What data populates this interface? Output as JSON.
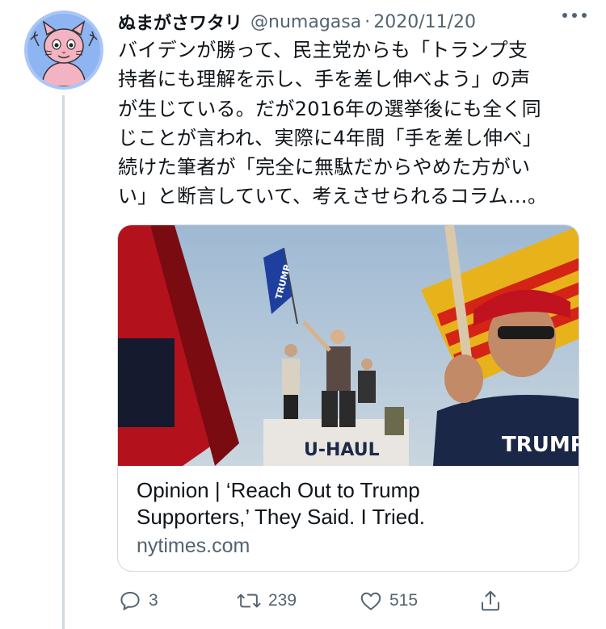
{
  "user": {
    "display_name": "ぬまがさワタリ",
    "handle": "@numagasa",
    "separator": "·",
    "date": "2020/11/20"
  },
  "tweet": {
    "lines": [
      "バイデンが勝って、民主党からも「トランプ支",
      "持者にも理解を示し、手を差し伸べよう」の声",
      "が生じている。だが2016年の選挙後にも全く同",
      "じことが言われ、実際に4年間「手を差し伸べ」",
      "続けた筆者が「完全に無駄だからやめた方がい",
      "い」と断言していて、考えさせられるコラム…。"
    ]
  },
  "card": {
    "title_line1": "Opinion | ‘Reach Out to Trump",
    "title_line2": "Supporters,’ They Said. I Tried.",
    "domain": "nytimes.com",
    "image": {
      "flag_text": "TRUMP",
      "shirt_text": "TRUMP",
      "truck_text": "U-HAUL"
    }
  },
  "actions": {
    "reply_count": "3",
    "retweet_count": "239",
    "like_count": "515"
  },
  "colors": {
    "text": "#0f1419",
    "secondary": "#536471",
    "border": "#cfd9de",
    "avatar_bg": "#8fb4f2"
  }
}
